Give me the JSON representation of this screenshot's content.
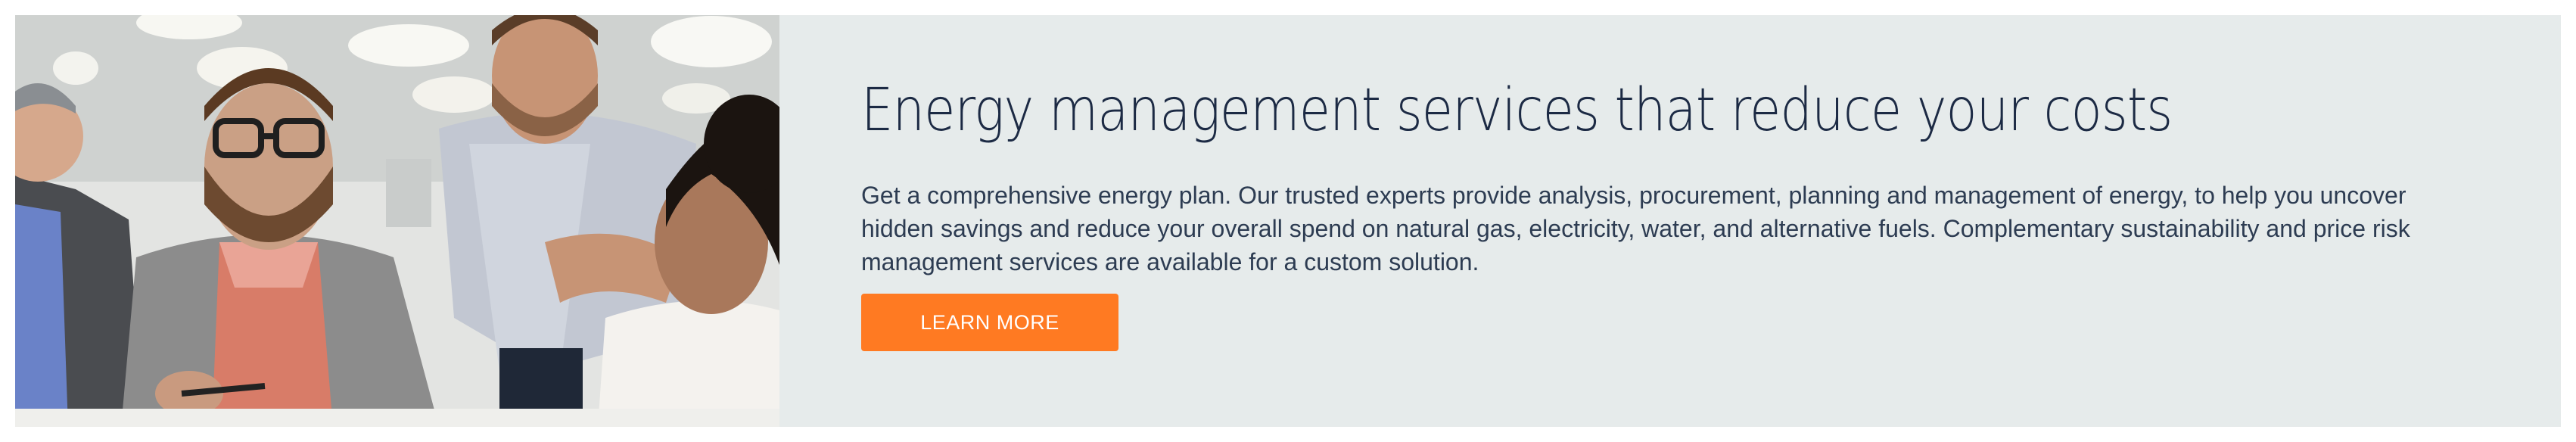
{
  "banner": {
    "image_alt": "",
    "headline": "Energy management services that reduce your costs",
    "body": "Get a comprehensive energy plan. Our trusted experts provide analysis, procurement, planning and management of energy, to help you uncover hidden savings and reduce your overall spend on natural gas, electricity, water, and alternative fuels. Complementary sustainability and price risk management services are available for a custom solution.",
    "cta_label": "LEARN MORE"
  },
  "colors": {
    "panel_background": "#e6ebeb",
    "headline": "#1c2a44",
    "cta_background": "#ff7a22",
    "cta_text": "#ffffff"
  }
}
